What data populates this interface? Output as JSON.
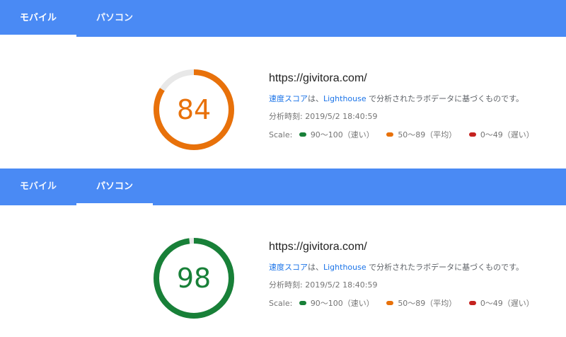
{
  "colors": {
    "tabbar": "#4a8af4",
    "fast": "#188038",
    "average": "#e8710a",
    "slow": "#c5221f",
    "link": "#1a73e8",
    "gauge_track": "#e8e8e8"
  },
  "sections": [
    {
      "tabs": [
        {
          "label": "モバイル",
          "active": true
        },
        {
          "label": "パソコン",
          "active": false
        }
      ],
      "score": 84,
      "score_color": "#e8710a",
      "url": "https://givitora.com/",
      "desc_link1": "速度スコア",
      "desc_mid": "は、",
      "desc_link2": "Lighthouse",
      "desc_rest": " で分析されたラボデータに基づくものです。",
      "timestamp": "分析時刻: 2019/5/2 18:40:59",
      "scale_label": "Scale:",
      "scale": [
        {
          "text": "90〜100（速い）",
          "color": "#188038"
        },
        {
          "text": "50〜89（平均）",
          "color": "#e8710a"
        },
        {
          "text": "0〜49（遅い）",
          "color": "#c5221f"
        }
      ]
    },
    {
      "tabs": [
        {
          "label": "モバイル",
          "active": false
        },
        {
          "label": "パソコン",
          "active": true
        }
      ],
      "score": 98,
      "score_color": "#188038",
      "url": "https://givitora.com/",
      "desc_link1": "速度スコア",
      "desc_mid": "は、",
      "desc_link2": "Lighthouse",
      "desc_rest": " で分析されたラボデータに基づくものです。",
      "timestamp": "分析時刻: 2019/5/2 18:40:59",
      "scale_label": "Scale:",
      "scale": [
        {
          "text": "90〜100（速い）",
          "color": "#188038"
        },
        {
          "text": "50〜89（平均）",
          "color": "#e8710a"
        },
        {
          "text": "0〜49（遅い）",
          "color": "#c5221f"
        }
      ]
    }
  ]
}
